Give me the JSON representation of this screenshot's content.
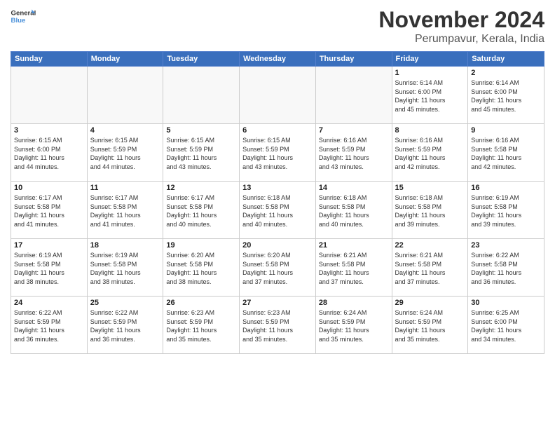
{
  "logo": {
    "line1": "General",
    "line2": "Blue"
  },
  "title": "November 2024",
  "location": "Perumpavur, Kerala, India",
  "days_of_week": [
    "Sunday",
    "Monday",
    "Tuesday",
    "Wednesday",
    "Thursday",
    "Friday",
    "Saturday"
  ],
  "weeks": [
    [
      {
        "num": "",
        "info": ""
      },
      {
        "num": "",
        "info": ""
      },
      {
        "num": "",
        "info": ""
      },
      {
        "num": "",
        "info": ""
      },
      {
        "num": "",
        "info": ""
      },
      {
        "num": "1",
        "info": "Sunrise: 6:14 AM\nSunset: 6:00 PM\nDaylight: 11 hours\nand 45 minutes."
      },
      {
        "num": "2",
        "info": "Sunrise: 6:14 AM\nSunset: 6:00 PM\nDaylight: 11 hours\nand 45 minutes."
      }
    ],
    [
      {
        "num": "3",
        "info": "Sunrise: 6:15 AM\nSunset: 6:00 PM\nDaylight: 11 hours\nand 44 minutes."
      },
      {
        "num": "4",
        "info": "Sunrise: 6:15 AM\nSunset: 5:59 PM\nDaylight: 11 hours\nand 44 minutes."
      },
      {
        "num": "5",
        "info": "Sunrise: 6:15 AM\nSunset: 5:59 PM\nDaylight: 11 hours\nand 43 minutes."
      },
      {
        "num": "6",
        "info": "Sunrise: 6:15 AM\nSunset: 5:59 PM\nDaylight: 11 hours\nand 43 minutes."
      },
      {
        "num": "7",
        "info": "Sunrise: 6:16 AM\nSunset: 5:59 PM\nDaylight: 11 hours\nand 43 minutes."
      },
      {
        "num": "8",
        "info": "Sunrise: 6:16 AM\nSunset: 5:59 PM\nDaylight: 11 hours\nand 42 minutes."
      },
      {
        "num": "9",
        "info": "Sunrise: 6:16 AM\nSunset: 5:58 PM\nDaylight: 11 hours\nand 42 minutes."
      }
    ],
    [
      {
        "num": "10",
        "info": "Sunrise: 6:17 AM\nSunset: 5:58 PM\nDaylight: 11 hours\nand 41 minutes."
      },
      {
        "num": "11",
        "info": "Sunrise: 6:17 AM\nSunset: 5:58 PM\nDaylight: 11 hours\nand 41 minutes."
      },
      {
        "num": "12",
        "info": "Sunrise: 6:17 AM\nSunset: 5:58 PM\nDaylight: 11 hours\nand 40 minutes."
      },
      {
        "num": "13",
        "info": "Sunrise: 6:18 AM\nSunset: 5:58 PM\nDaylight: 11 hours\nand 40 minutes."
      },
      {
        "num": "14",
        "info": "Sunrise: 6:18 AM\nSunset: 5:58 PM\nDaylight: 11 hours\nand 40 minutes."
      },
      {
        "num": "15",
        "info": "Sunrise: 6:18 AM\nSunset: 5:58 PM\nDaylight: 11 hours\nand 39 minutes."
      },
      {
        "num": "16",
        "info": "Sunrise: 6:19 AM\nSunset: 5:58 PM\nDaylight: 11 hours\nand 39 minutes."
      }
    ],
    [
      {
        "num": "17",
        "info": "Sunrise: 6:19 AM\nSunset: 5:58 PM\nDaylight: 11 hours\nand 38 minutes."
      },
      {
        "num": "18",
        "info": "Sunrise: 6:19 AM\nSunset: 5:58 PM\nDaylight: 11 hours\nand 38 minutes."
      },
      {
        "num": "19",
        "info": "Sunrise: 6:20 AM\nSunset: 5:58 PM\nDaylight: 11 hours\nand 38 minutes."
      },
      {
        "num": "20",
        "info": "Sunrise: 6:20 AM\nSunset: 5:58 PM\nDaylight: 11 hours\nand 37 minutes."
      },
      {
        "num": "21",
        "info": "Sunrise: 6:21 AM\nSunset: 5:58 PM\nDaylight: 11 hours\nand 37 minutes."
      },
      {
        "num": "22",
        "info": "Sunrise: 6:21 AM\nSunset: 5:58 PM\nDaylight: 11 hours\nand 37 minutes."
      },
      {
        "num": "23",
        "info": "Sunrise: 6:22 AM\nSunset: 5:58 PM\nDaylight: 11 hours\nand 36 minutes."
      }
    ],
    [
      {
        "num": "24",
        "info": "Sunrise: 6:22 AM\nSunset: 5:59 PM\nDaylight: 11 hours\nand 36 minutes."
      },
      {
        "num": "25",
        "info": "Sunrise: 6:22 AM\nSunset: 5:59 PM\nDaylight: 11 hours\nand 36 minutes."
      },
      {
        "num": "26",
        "info": "Sunrise: 6:23 AM\nSunset: 5:59 PM\nDaylight: 11 hours\nand 35 minutes."
      },
      {
        "num": "27",
        "info": "Sunrise: 6:23 AM\nSunset: 5:59 PM\nDaylight: 11 hours\nand 35 minutes."
      },
      {
        "num": "28",
        "info": "Sunrise: 6:24 AM\nSunset: 5:59 PM\nDaylight: 11 hours\nand 35 minutes."
      },
      {
        "num": "29",
        "info": "Sunrise: 6:24 AM\nSunset: 5:59 PM\nDaylight: 11 hours\nand 35 minutes."
      },
      {
        "num": "30",
        "info": "Sunrise: 6:25 AM\nSunset: 6:00 PM\nDaylight: 11 hours\nand 34 minutes."
      }
    ]
  ]
}
